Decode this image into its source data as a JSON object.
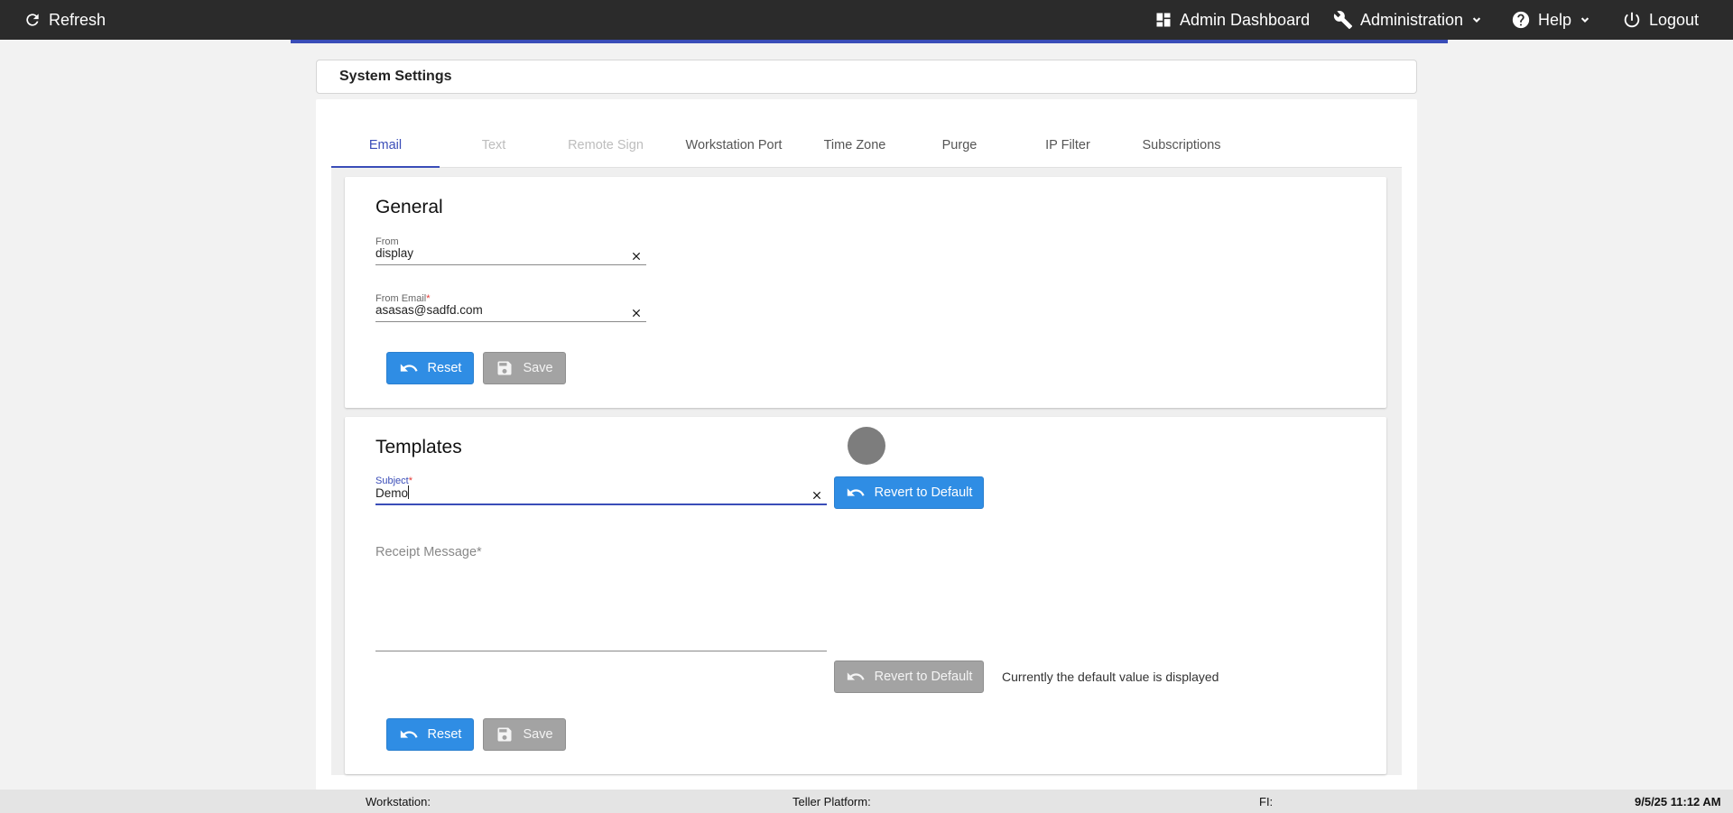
{
  "topbar": {
    "refresh_label": "Refresh",
    "admin_dashboard_label": "Admin Dashboard",
    "administration_label": "Administration",
    "help_label": "Help",
    "logout_label": "Logout"
  },
  "header": {
    "title": "System Settings"
  },
  "tabs": [
    {
      "label": "Email",
      "state": "active"
    },
    {
      "label": "Text",
      "state": "disabled"
    },
    {
      "label": "Remote Sign",
      "state": "disabled"
    },
    {
      "label": "Workstation Port",
      "state": "normal"
    },
    {
      "label": "Time Zone",
      "state": "normal"
    },
    {
      "label": "Purge",
      "state": "normal"
    },
    {
      "label": "IP Filter",
      "state": "normal"
    },
    {
      "label": "Subscriptions",
      "state": "normal"
    }
  ],
  "general": {
    "title": "General",
    "from": {
      "label": "From",
      "value": "display"
    },
    "from_email": {
      "label": "From Email",
      "required_mark": "*",
      "value": "asasas@sadfd.com"
    },
    "reset_label": "Reset",
    "save_label": "Save"
  },
  "templates": {
    "title": "Templates",
    "subject": {
      "label": "Subject",
      "required_mark": "*",
      "value": "Demo"
    },
    "revert_label": "Revert to Default",
    "receipt_message": {
      "label": "Receipt Message",
      "required_mark": "*",
      "value": ""
    },
    "receipt_revert_label": "Revert to Default",
    "default_note": "Currently the default value is displayed",
    "reset_label": "Reset",
    "save_label": "Save"
  },
  "footer": {
    "workstation_label": "Workstation:",
    "teller_platform_label": "Teller Platform:",
    "fi_label": "FI:",
    "timestamp": "9/5/25 11:12 AM"
  },
  "colors": {
    "topbar_bg": "#2b2b2b",
    "accent": "#3a4db8",
    "primary_button": "#2f8de4",
    "disabled_button": "#a3a3a3",
    "required": "#e53935"
  },
  "icons": {
    "refresh": "refresh-icon",
    "dashboard": "dashboard-icon",
    "administration": "wrench-icon",
    "help": "help-circle-icon",
    "logout": "power-icon",
    "clear": "close-icon",
    "reset": "undo-icon",
    "save": "floppy-disk-icon"
  }
}
